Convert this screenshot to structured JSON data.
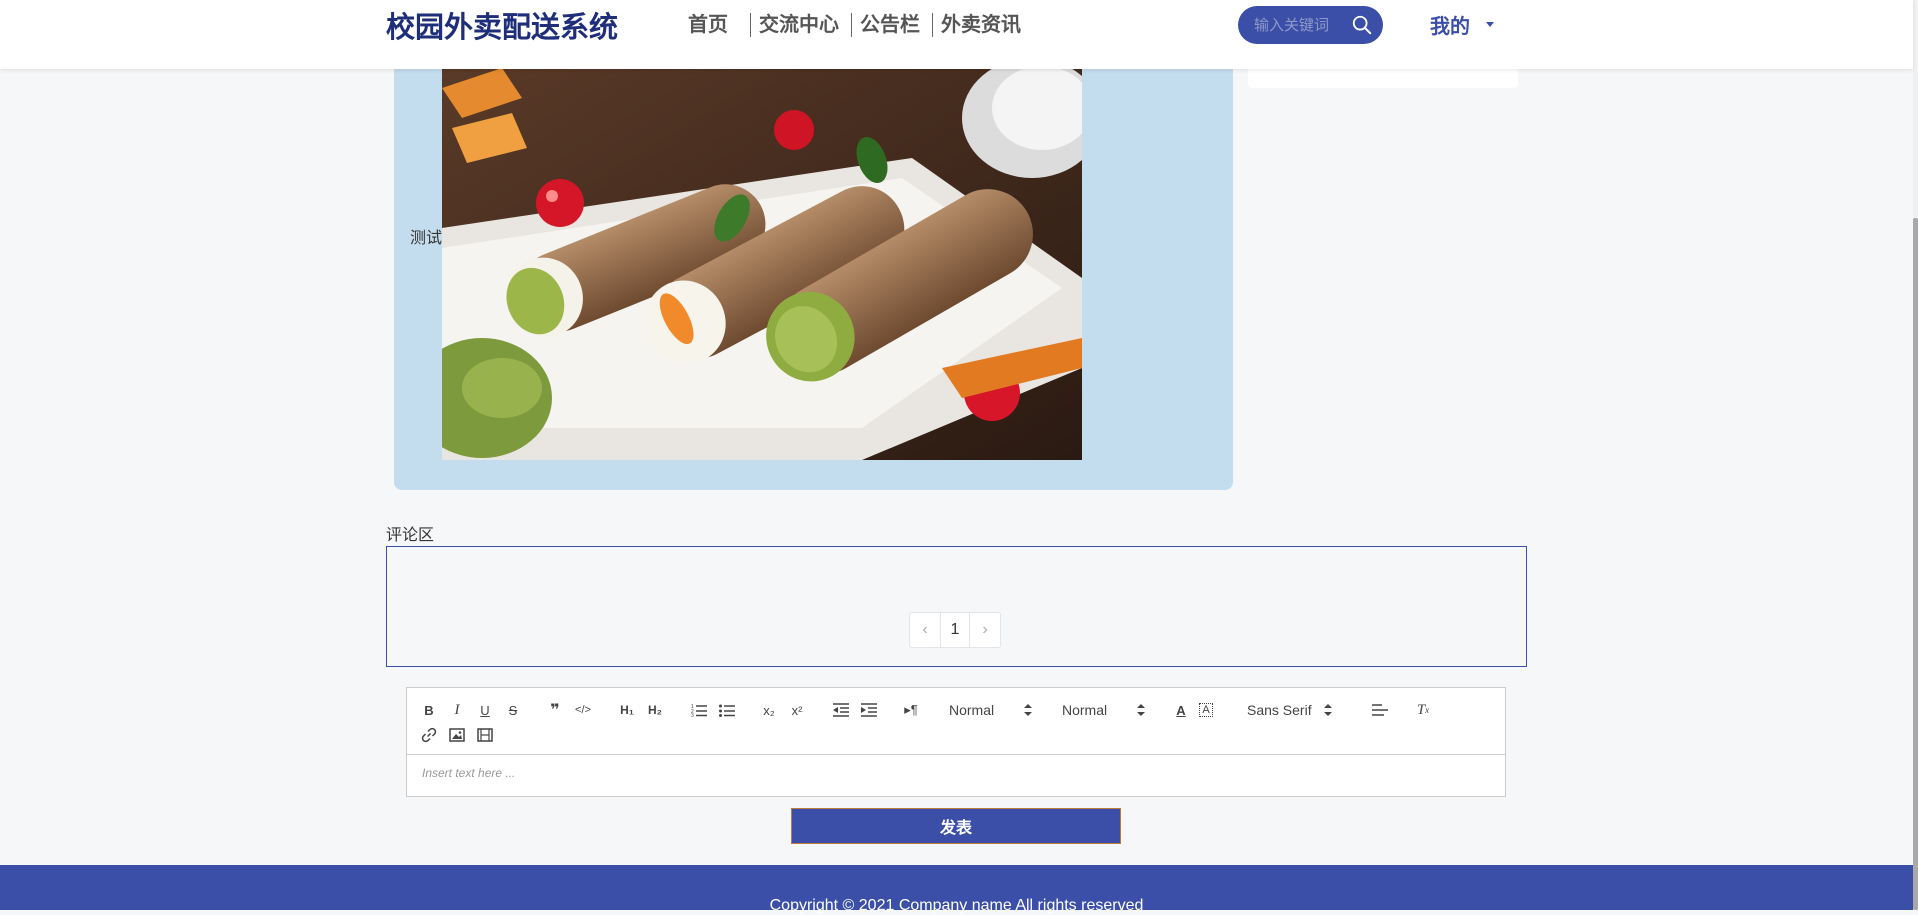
{
  "header": {
    "site_title": "校园外卖配送系统",
    "nav": [
      "首页",
      "交流中心",
      "公告栏",
      "外卖资讯"
    ],
    "search_placeholder": "输入关键词",
    "user_menu": "我的"
  },
  "content": {
    "text": "测试",
    "image_icon": "food-photo"
  },
  "comments": {
    "title": "评论区",
    "pagination": {
      "prev": "‹",
      "page": "1",
      "next": "›"
    }
  },
  "editor": {
    "header_select": "Normal",
    "size_select": "Normal",
    "font_select": "Sans Serif",
    "placeholder": "Insert text here ..."
  },
  "submit_label": "发表",
  "footer": {
    "copyright": "Copyright © 2021 Company name All rights reserved"
  },
  "colors": {
    "brand": "#3c4fa8",
    "title": "#1e2e7a",
    "panel": "#c3dcee",
    "page_bg": "#f5f7f8"
  }
}
